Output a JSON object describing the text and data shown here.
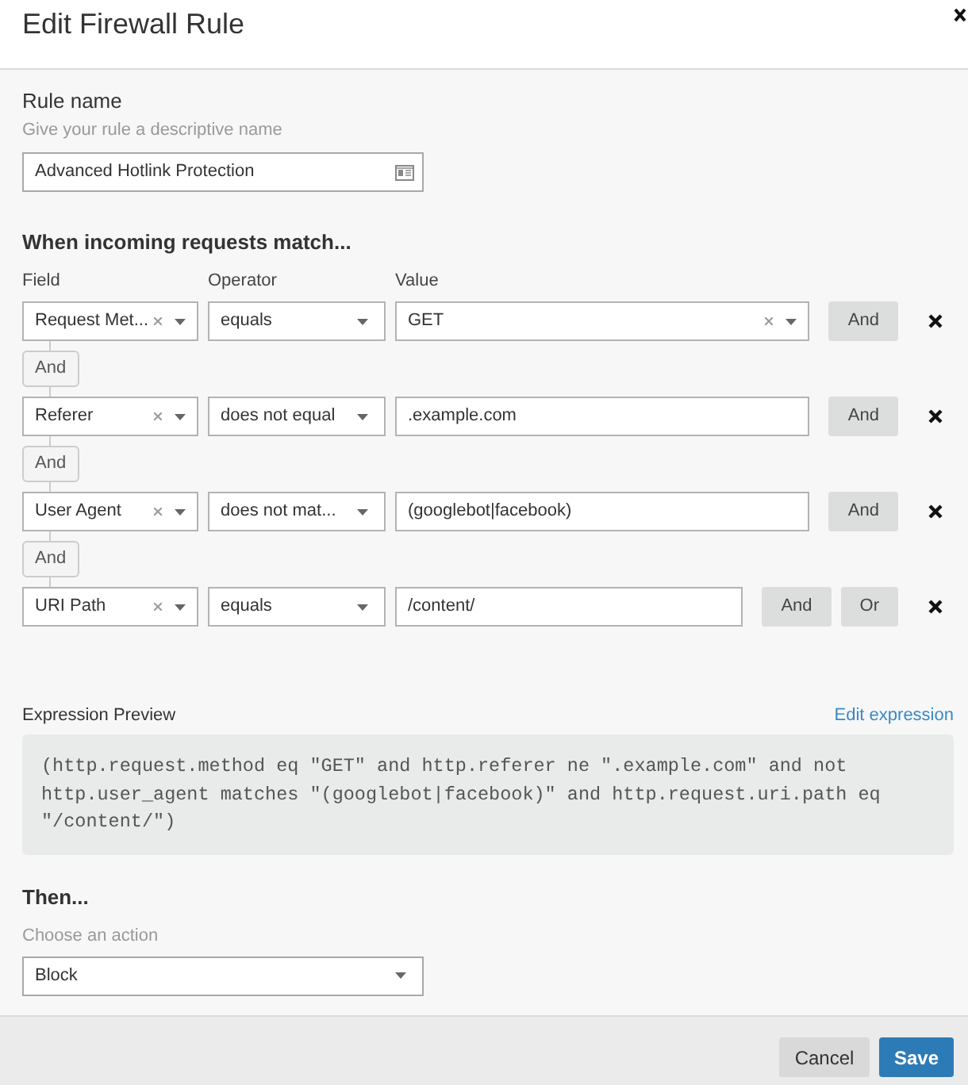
{
  "dialog": {
    "title": "Edit Firewall Rule"
  },
  "rule_name": {
    "label": "Rule name",
    "hint": "Give your rule a descriptive name",
    "value": "Advanced Hotlink Protection"
  },
  "conditions": {
    "heading": "When incoming requests match...",
    "columns": [
      "Field",
      "Operator",
      "Value"
    ],
    "rows": [
      {
        "field": "Request Met...",
        "operator": "equals",
        "value": {
          "kind": "select",
          "text": "GET"
        },
        "buttons": [
          "And"
        ],
        "joiner": "And"
      },
      {
        "field": "Referer",
        "operator": "does not equal",
        "value": {
          "kind": "input",
          "text": ".example.com"
        },
        "buttons": [
          "And"
        ],
        "joiner": "And"
      },
      {
        "field": "User Agent",
        "operator": "does not mat...",
        "value": {
          "kind": "input",
          "text": "(googlebot|facebook)"
        },
        "buttons": [
          "And"
        ],
        "joiner": "And"
      },
      {
        "field": "URI Path",
        "operator": "equals",
        "value": {
          "kind": "input",
          "text": "/content/"
        },
        "buttons": [
          "And",
          "Or"
        ]
      }
    ]
  },
  "expression_preview": {
    "label": "Expression Preview",
    "link": "Edit expression",
    "code": "(http.request.method eq \"GET\" and http.referer ne \".example.com\" and not http.user_agent matches \"(googlebot|facebook)\" and http.request.uri.path eq \"/content/\")"
  },
  "action": {
    "heading": "Then...",
    "label": "Choose an action",
    "value": "Block"
  },
  "footer": {
    "buttons": [
      {
        "label": "Cancel",
        "kind": "secondary"
      },
      {
        "label": "Save",
        "kind": "primary"
      }
    ]
  }
}
